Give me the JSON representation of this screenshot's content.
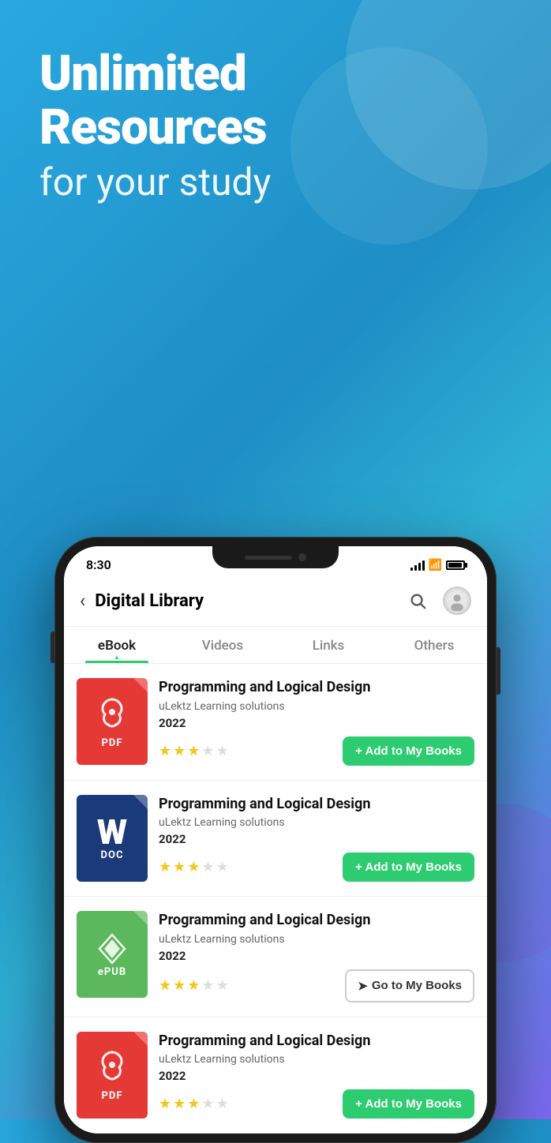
{
  "background": {
    "gradient_start": "#29a8e0",
    "gradient_end": "#7b68ee"
  },
  "hero": {
    "title_line1": "Unlimited",
    "title_line2": "Resources",
    "subtitle": "for your study"
  },
  "phone": {
    "status_bar": {
      "time": "8:30"
    },
    "header": {
      "back_label": "‹",
      "title": "Digital Library",
      "search_label": "🔍"
    },
    "tabs": [
      {
        "id": "ebook",
        "label": "eBook",
        "active": true
      },
      {
        "id": "videos",
        "label": "Videos",
        "active": false
      },
      {
        "id": "links",
        "label": "Links",
        "active": false
      },
      {
        "id": "others",
        "label": "Others",
        "active": false
      }
    ],
    "books": [
      {
        "id": "book-1",
        "cover_type": "pdf",
        "cover_label": "PDF",
        "title": "Programming and Logical Design",
        "author": "uLektz Learning solutions",
        "year": "2022",
        "rating": 2.5,
        "stars": [
          1,
          1,
          1,
          0,
          0
        ],
        "action": "add",
        "action_label": "+ Add to My Books"
      },
      {
        "id": "book-2",
        "cover_type": "doc",
        "cover_label": "DOC",
        "title": "Programming and Logical Design",
        "author": "uLektz Learning solutions",
        "year": "2022",
        "rating": 2.5,
        "stars": [
          1,
          1,
          1,
          0,
          0
        ],
        "action": "add",
        "action_label": "+ Add to My Books"
      },
      {
        "id": "book-3",
        "cover_type": "epub",
        "cover_label": "ePUB",
        "title": "Programming and Logical Design",
        "author": "uLektz Learning solutions",
        "year": "2022",
        "rating": 3,
        "stars": [
          1,
          1,
          1,
          0,
          0
        ],
        "action": "goto",
        "action_label": "➤ Go to My Books"
      },
      {
        "id": "book-4",
        "cover_type": "pdf",
        "cover_label": "PDF",
        "title": "Programming and Logical Design",
        "author": "uLektz Learning solutions",
        "year": "2022",
        "rating": 3,
        "stars": [
          1,
          1,
          1,
          0,
          0
        ],
        "action": "add",
        "action_label": "+ Add to My Books"
      }
    ]
  }
}
